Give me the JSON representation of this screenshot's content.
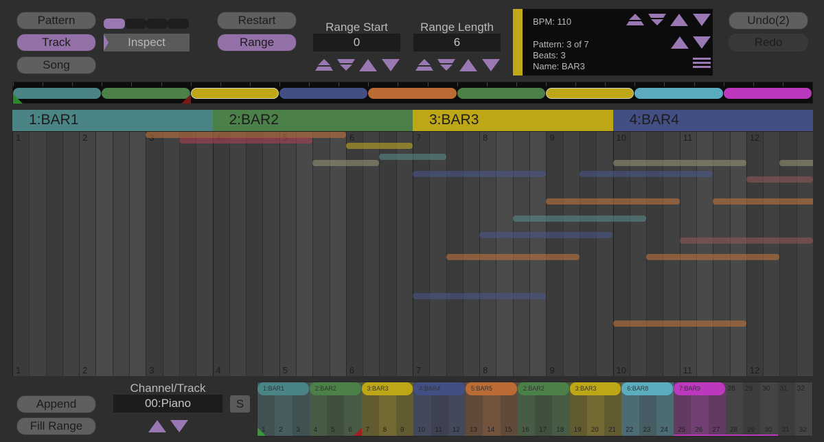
{
  "mode_buttons": [
    {
      "label": "Pattern",
      "active": false
    },
    {
      "label": "Track",
      "active": true
    },
    {
      "label": "Song",
      "active": false
    }
  ],
  "track_slots": {
    "count": 4,
    "selected": 0
  },
  "inspect_label": "Inspect",
  "restart_label": "Restart",
  "range_label": "Range",
  "range_start": {
    "label": "Range Start",
    "value": "0"
  },
  "range_length": {
    "label": "Range Length",
    "value": "6"
  },
  "info": {
    "bpm": "BPM: 110",
    "pattern": "Pattern: 3 of 7",
    "beats": "Beats: 3",
    "name": "Name: BAR3",
    "accent": "#c0a818"
  },
  "undo_label": "Undo(2)",
  "redo_label": "Redo",
  "song": {
    "patterns": [
      {
        "name": "BAR1",
        "color": "#4b8484",
        "selected": false
      },
      {
        "name": "BAR2",
        "color": "#4b8048",
        "selected": false
      },
      {
        "name": "BAR3",
        "color": "#bea716",
        "selected": true
      },
      {
        "name": "BAR4",
        "color": "#434f82",
        "selected": false
      },
      {
        "name": "BAR5",
        "color": "#bb6c34",
        "selected": false
      },
      {
        "name": "BAR2",
        "color": "#4b8048",
        "selected": false
      },
      {
        "name": "BAR3",
        "color": "#bea716",
        "selected": true
      },
      {
        "name": "BAR8",
        "color": "#5cacc0",
        "selected": false
      },
      {
        "name": "BAR9",
        "color": "#bc38bc",
        "selected": false
      }
    ],
    "minimap_labels": [
      "1:BAR1",
      "2:BAR2",
      "3:BAR3",
      "4:BAR4",
      "5:BAR5",
      "2:BAR2",
      "3:BAR3",
      "6:BAR8",
      "7:BAR9"
    ],
    "total_beats": 32
  },
  "view": {
    "headers": [
      {
        "label": "1:BAR1",
        "color": "#4b8484"
      },
      {
        "label": "2:BAR2",
        "color": "#4b8048"
      },
      {
        "label": "3:BAR3",
        "color": "#bea716"
      },
      {
        "label": "4:BAR4",
        "color": "#434f82"
      }
    ],
    "beats": [
      "1",
      "2",
      "3",
      "4",
      "5",
      "6",
      "7",
      "8",
      "9",
      "10",
      "11",
      "12"
    ],
    "notes": [
      {
        "start": 2.0,
        "len": 3.0,
        "row": 0,
        "color": "#c8783a"
      },
      {
        "start": 2.5,
        "len": 2.0,
        "row": 1,
        "color": "#b04050"
      },
      {
        "start": 5.0,
        "len": 1.0,
        "row": 2,
        "color": "#c8b020"
      },
      {
        "start": 5.5,
        "len": 1.0,
        "row": 4,
        "color": "#5a9090"
      },
      {
        "start": 4.5,
        "len": 1.0,
        "row": 5,
        "color": "#9a9878"
      },
      {
        "start": 6.0,
        "len": 2.0,
        "row": 7,
        "color": "#4a5890"
      },
      {
        "start": 8.5,
        "len": 2.0,
        "row": 7,
        "color": "#4a5890"
      },
      {
        "start": 9.0,
        "len": 2.0,
        "row": 5,
        "color": "#9a9878"
      },
      {
        "start": 11.5,
        "len": 1.0,
        "row": 5,
        "color": "#9a9878"
      },
      {
        "start": 11.0,
        "len": 1.0,
        "row": 8,
        "color": "#985858"
      },
      {
        "start": 8.0,
        "len": 2.0,
        "row": 12,
        "color": "#c8783a"
      },
      {
        "start": 10.5,
        "len": 2.0,
        "row": 12,
        "color": "#c8783a"
      },
      {
        "start": 7.5,
        "len": 2.0,
        "row": 15,
        "color": "#5a9090"
      },
      {
        "start": 7.0,
        "len": 2.0,
        "row": 18,
        "color": "#4a5890"
      },
      {
        "start": 10.0,
        "len": 2.0,
        "row": 19,
        "color": "#985858"
      },
      {
        "start": 6.5,
        "len": 2.0,
        "row": 22,
        "color": "#c8783a"
      },
      {
        "start": 9.5,
        "len": 2.0,
        "row": 22,
        "color": "#c8783a"
      },
      {
        "start": 6.0,
        "len": 2.0,
        "row": 29,
        "color": "#4a5890"
      },
      {
        "start": 9.0,
        "len": 2.0,
        "row": 34,
        "color": "#c8783a"
      }
    ]
  },
  "channel": {
    "label": "Channel/Track",
    "value": "00:Piano",
    "solo_label": "S"
  },
  "append_label": "Append",
  "fill_range_label": "Fill Range"
}
